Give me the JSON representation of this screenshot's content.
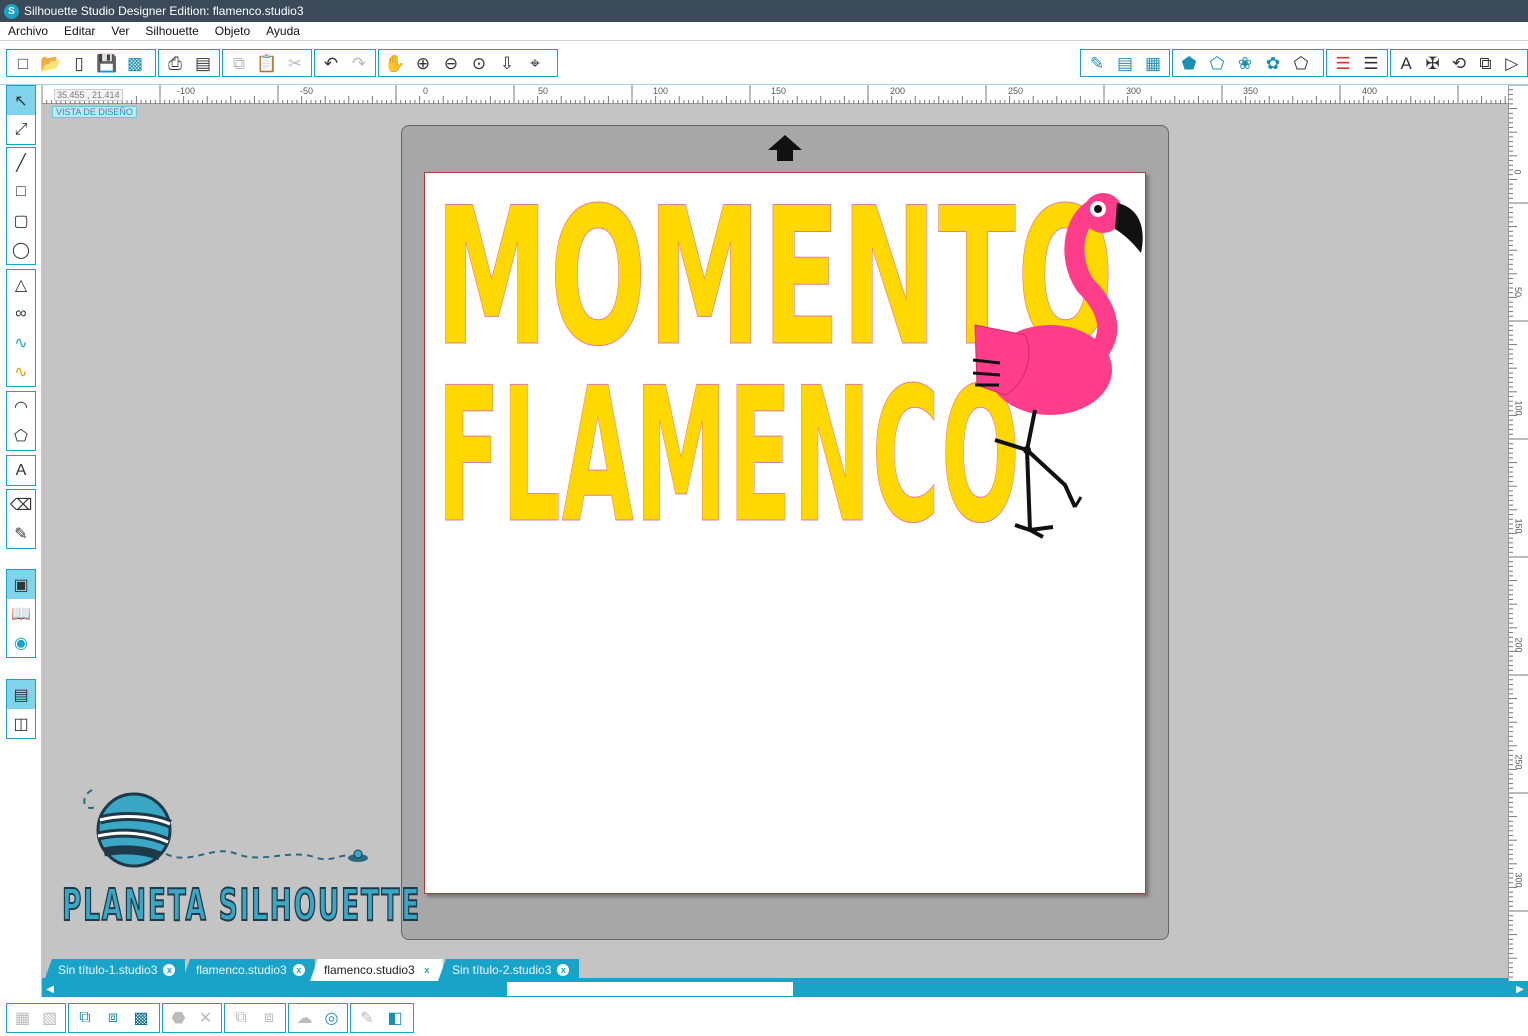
{
  "window": {
    "title": "Silhouette Studio Designer Edition: flamenco.studio3",
    "logo_letter": "S"
  },
  "menu": [
    "Archivo",
    "Editar",
    "Ver",
    "Silhouette",
    "Objeto",
    "Ayuda"
  ],
  "ruler": {
    "coordinates": "35.455 , 21.414",
    "top_labels": [
      "-100",
      "-50",
      "0",
      "50",
      "100",
      "150",
      "200",
      "250",
      "300",
      "350",
      "400"
    ],
    "right_labels": [
      "0",
      "50",
      "100",
      "150",
      "200",
      "250",
      "300"
    ]
  },
  "canvas": {
    "view_label": "VISTA DE DISEÑO",
    "design_line1": "MOMENTO",
    "design_line2": "FLAMENCO",
    "watermark": "PLANETA SILHOUETTE"
  },
  "tabs": [
    {
      "label": "Sin título-1.studio3",
      "active": false
    },
    {
      "label": "flamenco.studio3",
      "active": false
    },
    {
      "label": "flamenco.studio3",
      "active": true
    },
    {
      "label": "Sin título-2.studio3",
      "active": false
    }
  ],
  "tab_close_glyph": "x",
  "colors": {
    "accent": "#1aa3c8",
    "design_fill": "#ffd800",
    "flamingo": "#ff3d8b",
    "mat": "#a7a7a7"
  }
}
